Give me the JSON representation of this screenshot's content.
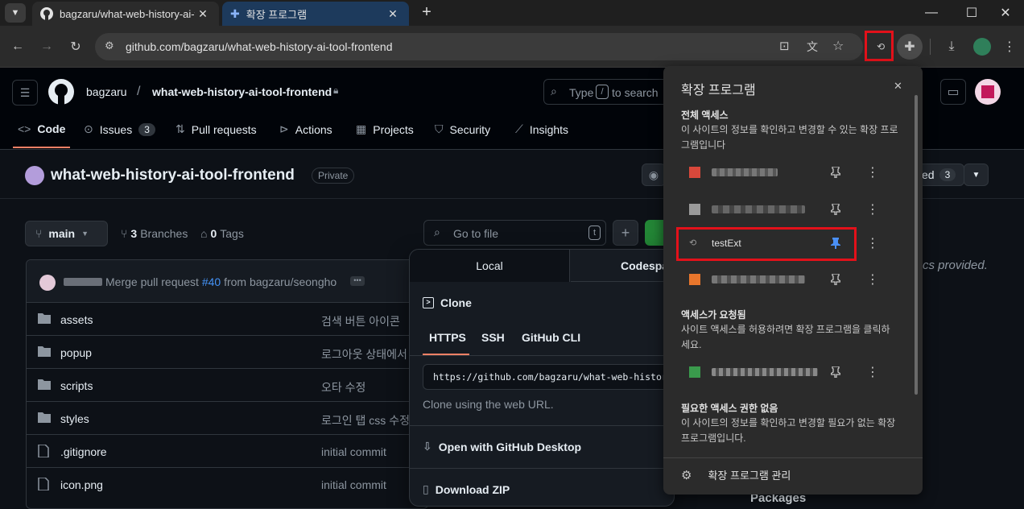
{
  "browser": {
    "tabs": [
      {
        "title": "bagzaru/what-web-history-ai-t",
        "active": true
      },
      {
        "title": "확장 프로그램",
        "active": false
      }
    ],
    "new_tab": "+",
    "window": {
      "minimize": "—",
      "maximize": "☐",
      "close": "✕"
    },
    "url": "github.com/bagzaru/what-web-history-ai-tool-frontend"
  },
  "github": {
    "owner": "bagzaru",
    "separator": "/",
    "repo": "what-web-history-ai-tool-frontend",
    "search_placeholder_pre": "Type",
    "search_key": "/",
    "search_placeholder_post": "to search",
    "nav": [
      {
        "label": "Code"
      },
      {
        "label": "Issues",
        "count": "3"
      },
      {
        "label": "Pull requests"
      },
      {
        "label": "Actions"
      },
      {
        "label": "Projects"
      },
      {
        "label": "Security"
      },
      {
        "label": "Insights"
      }
    ],
    "repo_title": "what-web-history-ai-tool-frontend",
    "visibility": "Private",
    "starred_suffix": "ed",
    "starred_count": "3",
    "branch": "main",
    "branches_count": "3",
    "branches_label": "Branches",
    "tags_count": "0",
    "tags_label": "Tags",
    "go_to_file": "Go to file",
    "go_to_file_key": "t",
    "about_tail": "cs provided.",
    "packages": "Packages",
    "commit": {
      "msg_pre": "Merge pull request",
      "pr": "#40",
      "msg_post": "from bagzaru/seongho"
    },
    "files": [
      {
        "name": "assets",
        "type": "dir",
        "commit": "검색 버튼 아이콘"
      },
      {
        "name": "popup",
        "type": "dir",
        "commit": "로그아웃 상태에서"
      },
      {
        "name": "scripts",
        "type": "dir",
        "commit": "오타 수정"
      },
      {
        "name": "styles",
        "type": "dir",
        "commit": "로그인 탭 css 수정"
      },
      {
        "name": ".gitignore",
        "type": "file",
        "commit": "initial commit"
      },
      {
        "name": "icon.png",
        "type": "file",
        "commit": "initial commit"
      }
    ],
    "code_popup": {
      "tab_local": "Local",
      "tab_codespaces": "Codespa",
      "clone": "Clone",
      "proto_tabs": [
        "HTTPS",
        "SSH",
        "GitHub CLI"
      ],
      "clone_url": "https://github.com/bagzaru/what-web-history-",
      "hint": "Clone using the web URL.",
      "open_desktop": "Open with GitHub Desktop",
      "download_zip": "Download ZIP"
    }
  },
  "extensions_popup": {
    "title": "확장 프로그램",
    "close": "✕",
    "full_access_heading": "전체 액세스",
    "full_access_desc": "이 사이트의 정보를 확인하고 변경할 수 있는 확장 프로그램입니다",
    "full_access_items": [
      {
        "name": "",
        "pinned": false,
        "favicon": "#d9483b"
      },
      {
        "name": "",
        "pinned": false,
        "favicon": "#9a9a9a"
      },
      {
        "name": "testExt",
        "pinned": true,
        "favicon": "#6b6b6b"
      },
      {
        "name": "",
        "pinned": false,
        "favicon": "#e8762c"
      }
    ],
    "requested_heading": "액세스가 요청됨",
    "requested_desc": "사이트 액세스를 허용하려면 확장 프로그램을 클릭하세요.",
    "requested_items": [
      {
        "name": "",
        "pinned": false,
        "favicon": "#3a9a4c"
      }
    ],
    "no_access_heading": "필요한 액세스 권한 없음",
    "no_access_desc": "이 사이트의 정보를 확인하고 변경할 필요가 없는 확장 프로그램입니다.",
    "manage": "확장 프로그램 관리"
  },
  "colors": {
    "highlight": "#e3111a",
    "pin_active": "#4a8ff5",
    "github_green": "#238636"
  }
}
